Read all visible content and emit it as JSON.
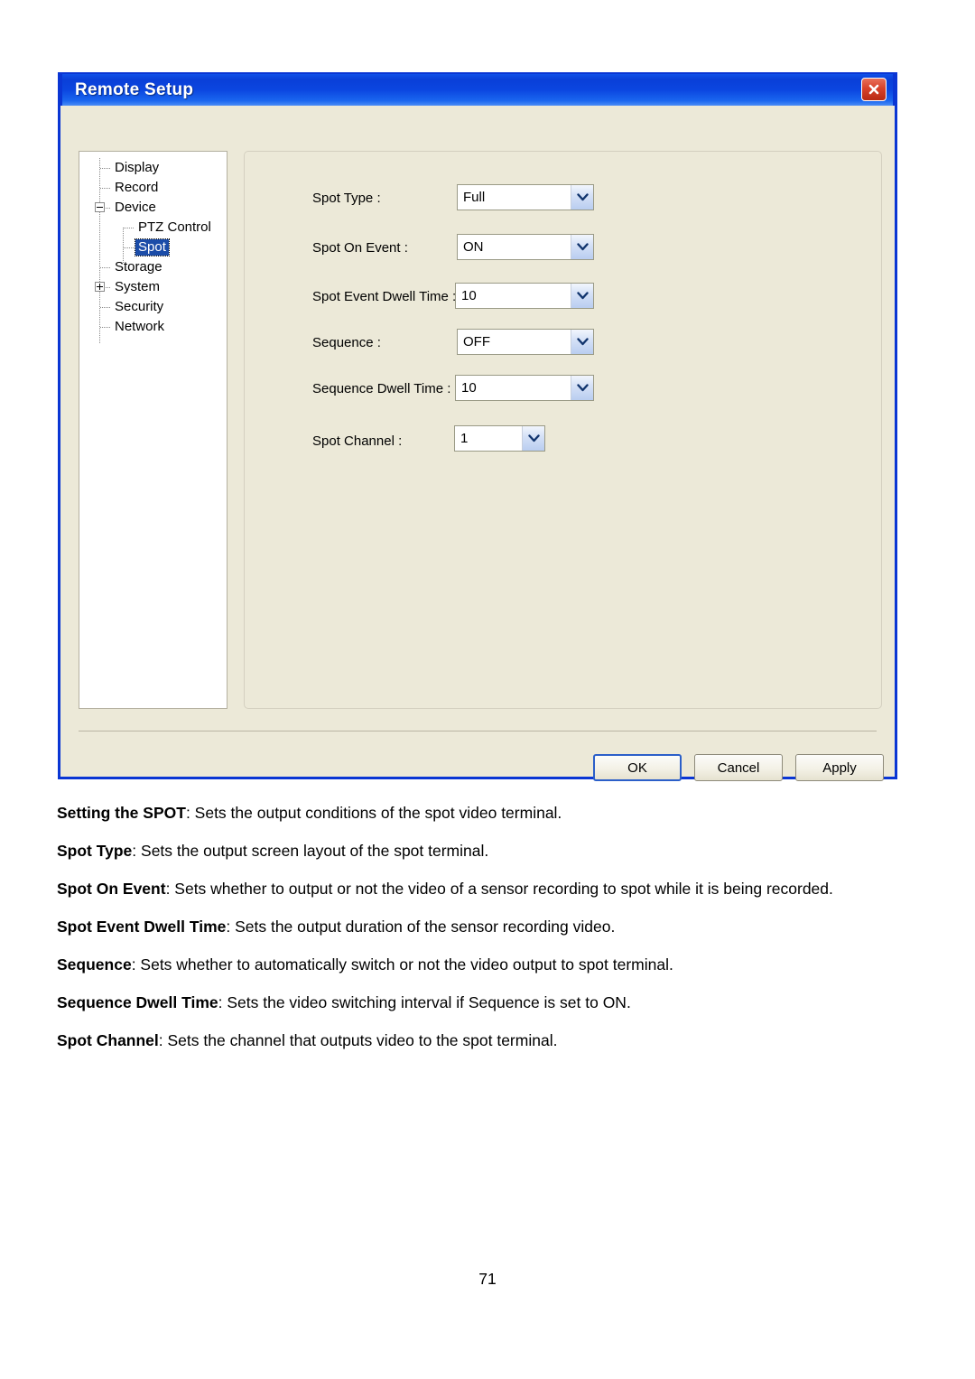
{
  "dialog": {
    "title": "Remote Setup",
    "close_icon": "close-icon",
    "tree": [
      {
        "label": "Display",
        "depth": 1,
        "state": "leaf",
        "selected": false
      },
      {
        "label": "Record",
        "depth": 1,
        "state": "leaf",
        "selected": false
      },
      {
        "label": "Device",
        "depth": 1,
        "state": "expanded",
        "selected": false
      },
      {
        "label": "PTZ Control",
        "depth": 2,
        "state": "leaf",
        "selected": false
      },
      {
        "label": "Spot",
        "depth": 2,
        "state": "leaf",
        "selected": true
      },
      {
        "label": "Storage",
        "depth": 1,
        "state": "leaf",
        "selected": false
      },
      {
        "label": "System",
        "depth": 1,
        "state": "collapsed",
        "selected": false
      },
      {
        "label": "Security",
        "depth": 1,
        "state": "leaf",
        "selected": false
      },
      {
        "label": "Network",
        "depth": 1,
        "state": "leaf",
        "selected": false
      }
    ],
    "fields": [
      {
        "label": "Spot Type :",
        "value": "Full"
      },
      {
        "label": "Spot On Event :",
        "value": "ON"
      },
      {
        "label": "Spot Event Dwell Time :",
        "value": "10"
      },
      {
        "label": "Sequence :",
        "value": "OFF"
      },
      {
        "label": "Sequence Dwell Time :",
        "value": "10"
      },
      {
        "label": "Spot Channel :",
        "value": "1"
      }
    ],
    "buttons": {
      "ok": "OK",
      "cancel": "Cancel",
      "apply": "Apply"
    }
  },
  "document": {
    "paragraphs": [
      {
        "term": "Setting the SPOT",
        "text": ": Sets the output conditions of the spot video terminal."
      },
      {
        "term": "Spot Type",
        "text": ": Sets the output screen layout of the spot terminal."
      },
      {
        "term": "Spot On Event",
        "text": ": Sets whether to output or not the video of a sensor recording to spot while it is being recorded."
      },
      {
        "term": "Spot Event Dwell Time",
        "text": ": Sets the output duration of the sensor recording video."
      },
      {
        "term": "Sequence",
        "text": ": Sets whether to automatically switch or not the video output to spot terminal."
      },
      {
        "term": "Sequence Dwell Time",
        "text": ": Sets the video switching interval if Sequence is set to ON."
      },
      {
        "term": "Spot Channel",
        "text": ": Sets the channel that outputs video to the spot terminal."
      }
    ],
    "page_number": "71"
  },
  "colors": {
    "titlebar_blue": "#0b46e0",
    "dialog_face": "#ece9d8",
    "selection_blue": "#1b4ca8",
    "close_red": "#d8422a"
  }
}
